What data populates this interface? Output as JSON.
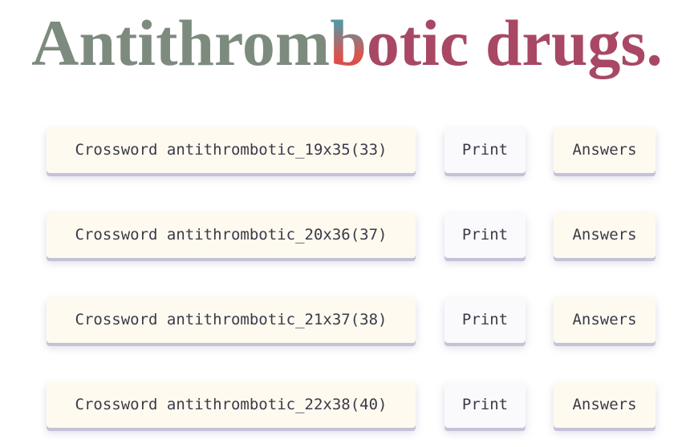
{
  "title": {
    "part1": "Antithrom",
    "part2": "b",
    "part3": "otic drugs."
  },
  "rows": [
    {
      "crossword": "Crossword antithrombotic_19x35(33)",
      "print": "Print",
      "answers": "Answers"
    },
    {
      "crossword": "Crossword antithrombotic_20x36(37)",
      "print": "Print",
      "answers": "Answers"
    },
    {
      "crossword": "Crossword antithrombotic_21x37(38)",
      "print": "Print",
      "answers": "Answers"
    },
    {
      "crossword": "Crossword antithrombotic_22x38(40)",
      "print": "Print",
      "answers": "Answers"
    }
  ],
  "colors": {
    "title_gray": "#7d8b7e",
    "title_accent_teal": "#19b5c8",
    "title_accent_red": "#e0524a",
    "title_maroon": "#a84864",
    "button_cream": "#fffaf0",
    "button_white": "#fafafc",
    "button_shadow": "#c5c2d8"
  }
}
